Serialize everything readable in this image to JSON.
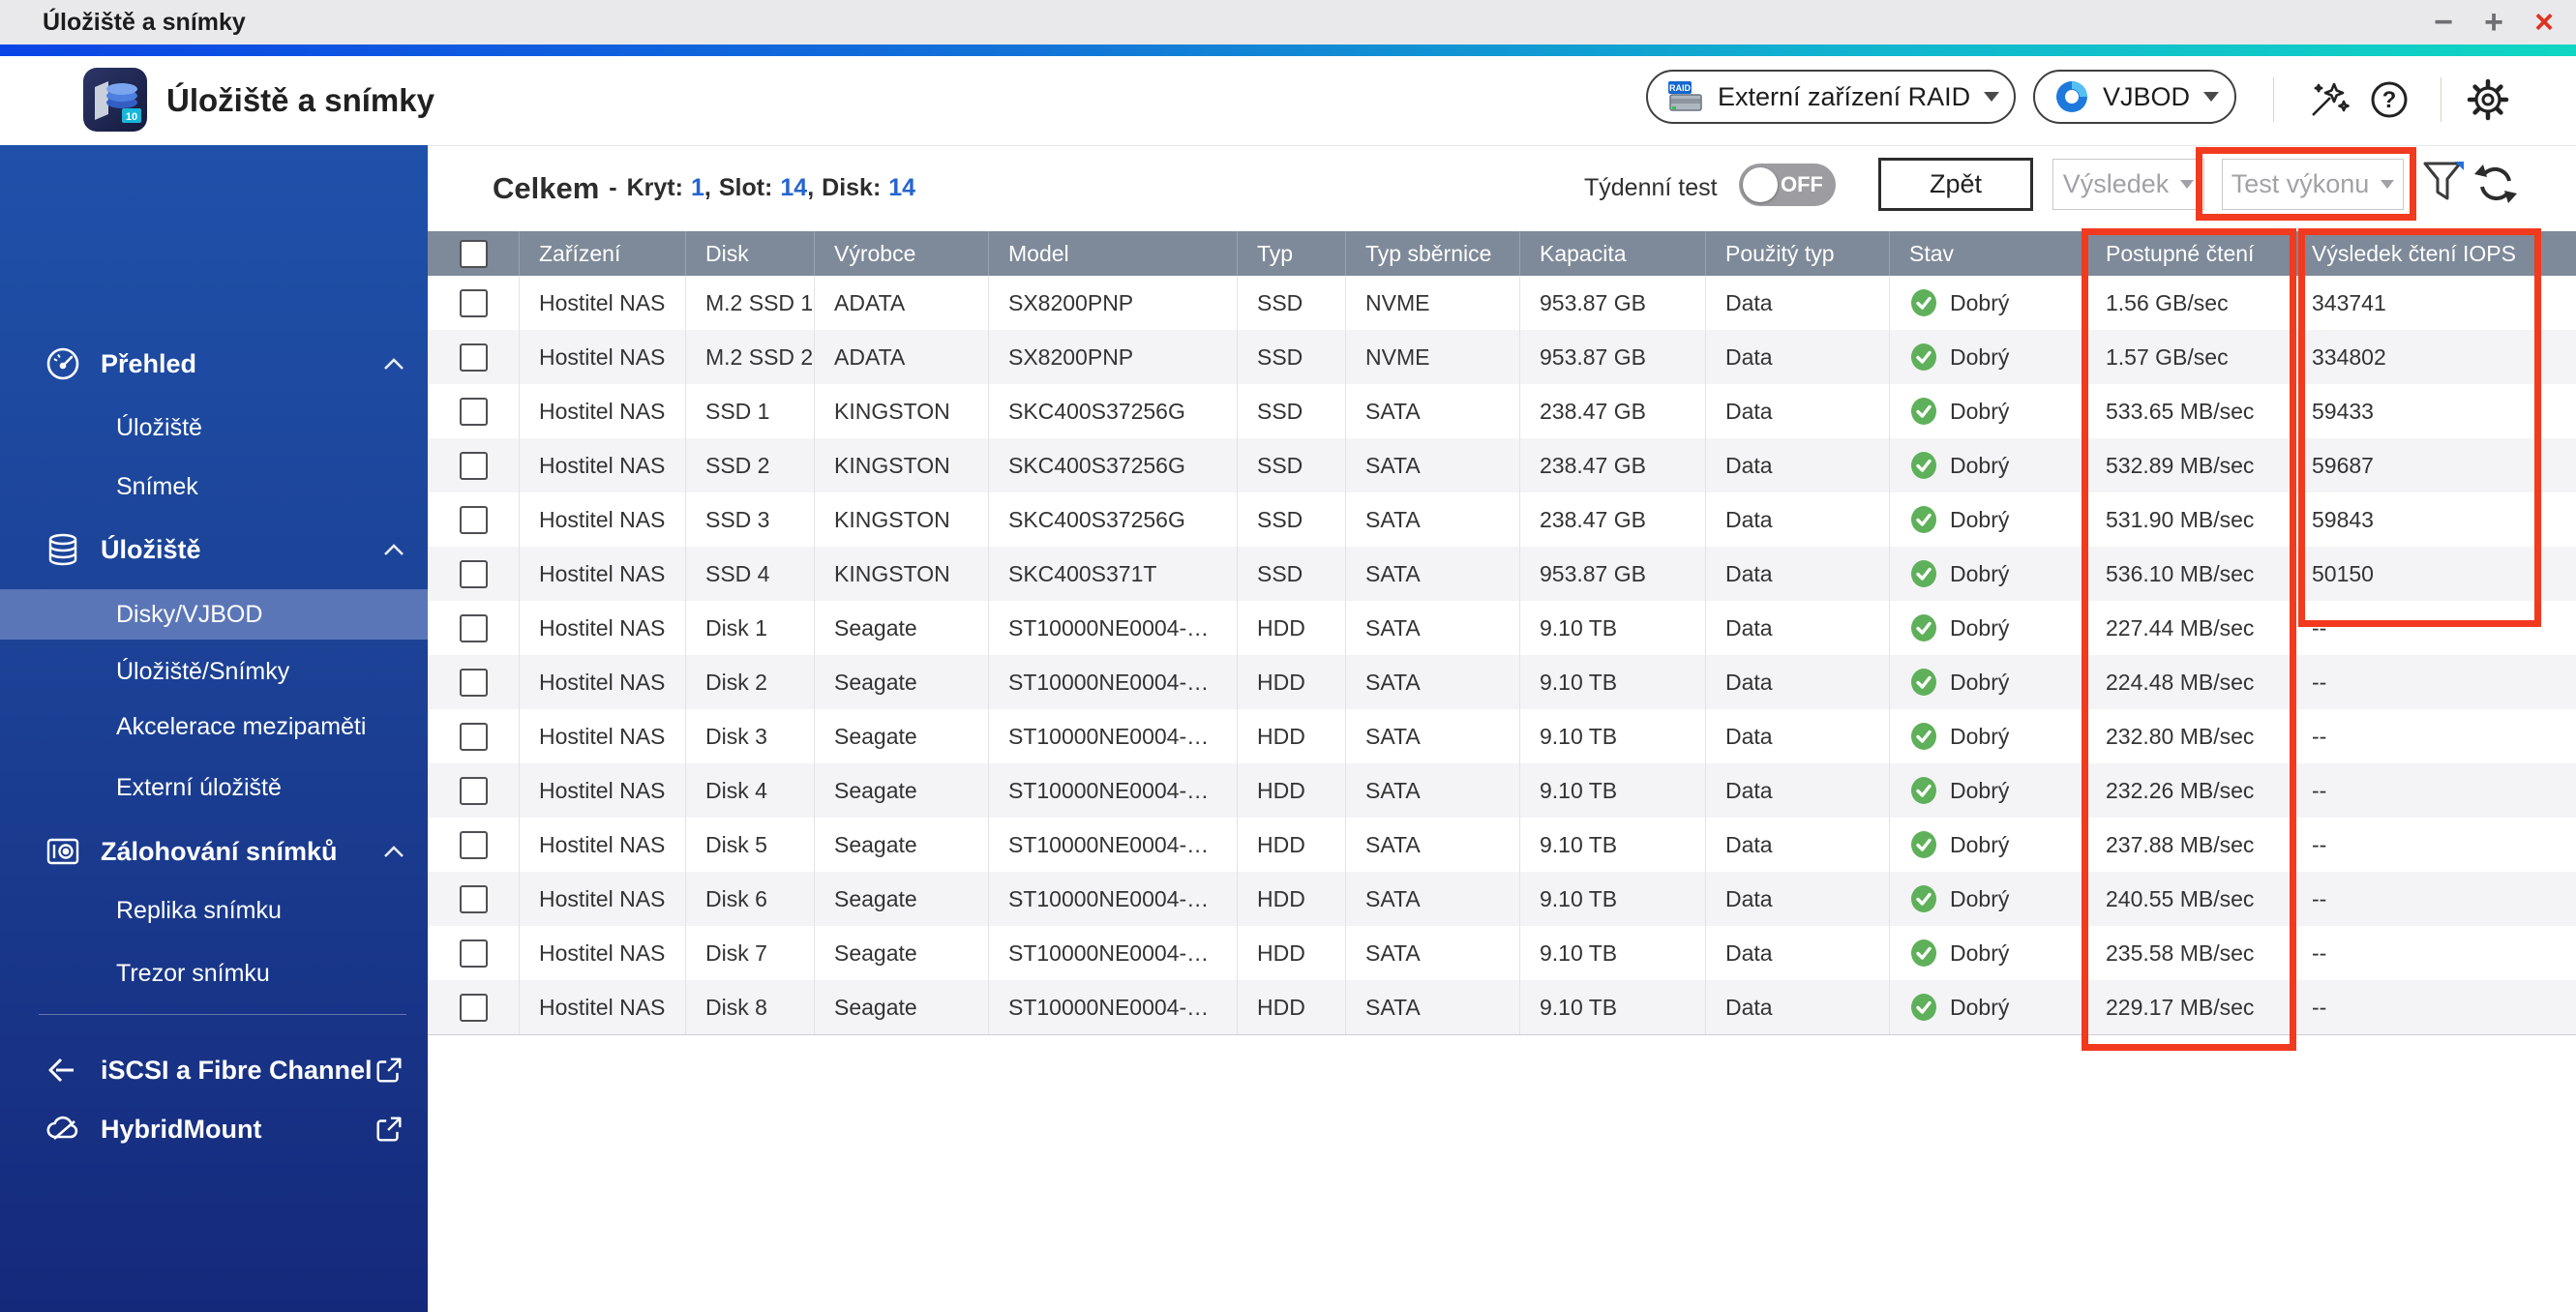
{
  "window": {
    "title": "Úložiště a snímky",
    "minimize": "−",
    "maximize": "+",
    "close": "×"
  },
  "app_header": {
    "title": "Úložiště a snímky",
    "app_icon_badge": "10",
    "raid_button_label": "Externí zařízení RAID",
    "raid_icon_text": "RAID",
    "vjbod_button_label": "VJBOD",
    "help_glyph": "?"
  },
  "sidebar": {
    "items": [
      {
        "label": "Přehled"
      },
      {
        "label": "Úložiště"
      },
      {
        "label": "Snímek"
      },
      {
        "label": "Úložiště"
      },
      {
        "label": "Disky/VJBOD"
      },
      {
        "label": "Úložiště/Snímky"
      },
      {
        "label": "Akcelerace mezipaměti"
      },
      {
        "label": "Externí úložiště"
      },
      {
        "label": "Zálohování snímků"
      },
      {
        "label": "Replika snímku"
      },
      {
        "label": "Trezor snímku"
      },
      {
        "label": "iSCSI a Fibre Channel"
      },
      {
        "label": "HybridMount"
      }
    ],
    "selected_item": "Disky/VJBOD"
  },
  "toolbar": {
    "summary": {
      "total": "Celkem",
      "dash": "-",
      "kryt_label": "Kryt:",
      "kryt_value": "1",
      "slot_label": "Slot:",
      "slot_value": "14",
      "disk_label": "Disk:",
      "disk_value": "14",
      "comma": ","
    },
    "weekly_test_label": "Týdenní test",
    "weekly_test_state": "OFF",
    "back_button": "Zpět",
    "result_button": "Výsledek",
    "performance_test_button": "Test výkonu"
  },
  "table": {
    "columns": [
      "Zařízení",
      "Disk",
      "Výrobce",
      "Model",
      "Typ",
      "Typ sběrnice",
      "Kapacita",
      "Použitý typ",
      "Stav",
      "Postupné čtení",
      "Výsledek čtení IOPS"
    ],
    "field_names": [
      "device",
      "disk",
      "vendor",
      "model",
      "type",
      "bus-type",
      "capacity",
      "used-type",
      "status",
      "seq-read",
      "read-iops"
    ],
    "rows": [
      [
        "Hostitel NAS",
        "M.2 SSD 1",
        "ADATA",
        "SX8200PNP",
        "SSD",
        "NVME",
        "953.87 GB",
        "Data",
        "Dobrý",
        "1.56 GB/sec",
        "343741"
      ],
      [
        "Hostitel NAS",
        "M.2 SSD 2",
        "ADATA",
        "SX8200PNP",
        "SSD",
        "NVME",
        "953.87 GB",
        "Data",
        "Dobrý",
        "1.57 GB/sec",
        "334802"
      ],
      [
        "Hostitel NAS",
        "SSD 1",
        "KINGSTON",
        "SKC400S37256G",
        "SSD",
        "SATA",
        "238.47 GB",
        "Data",
        "Dobrý",
        "533.65 MB/sec",
        "59433"
      ],
      [
        "Hostitel NAS",
        "SSD 2",
        "KINGSTON",
        "SKC400S37256G",
        "SSD",
        "SATA",
        "238.47 GB",
        "Data",
        "Dobrý",
        "532.89 MB/sec",
        "59687"
      ],
      [
        "Hostitel NAS",
        "SSD 3",
        "KINGSTON",
        "SKC400S37256G",
        "SSD",
        "SATA",
        "238.47 GB",
        "Data",
        "Dobrý",
        "531.90 MB/sec",
        "59843"
      ],
      [
        "Hostitel NAS",
        "SSD 4",
        "KINGSTON",
        "SKC400S371T",
        "SSD",
        "SATA",
        "953.87 GB",
        "Data",
        "Dobrý",
        "536.10 MB/sec",
        "50150"
      ],
      [
        "Hostitel NAS",
        "Disk 1",
        "Seagate",
        "ST10000NE0004-…",
        "HDD",
        "SATA",
        "9.10 TB",
        "Data",
        "Dobrý",
        "227.44 MB/sec",
        "--"
      ],
      [
        "Hostitel NAS",
        "Disk 2",
        "Seagate",
        "ST10000NE0004-…",
        "HDD",
        "SATA",
        "9.10 TB",
        "Data",
        "Dobrý",
        "224.48 MB/sec",
        "--"
      ],
      [
        "Hostitel NAS",
        "Disk 3",
        "Seagate",
        "ST10000NE0004-…",
        "HDD",
        "SATA",
        "9.10 TB",
        "Data",
        "Dobrý",
        "232.80 MB/sec",
        "--"
      ],
      [
        "Hostitel NAS",
        "Disk 4",
        "Seagate",
        "ST10000NE0004-…",
        "HDD",
        "SATA",
        "9.10 TB",
        "Data",
        "Dobrý",
        "232.26 MB/sec",
        "--"
      ],
      [
        "Hostitel NAS",
        "Disk 5",
        "Seagate",
        "ST10000NE0004-…",
        "HDD",
        "SATA",
        "9.10 TB",
        "Data",
        "Dobrý",
        "237.88 MB/sec",
        "--"
      ],
      [
        "Hostitel NAS",
        "Disk 6",
        "Seagate",
        "ST10000NE0004-…",
        "HDD",
        "SATA",
        "9.10 TB",
        "Data",
        "Dobrý",
        "240.55 MB/sec",
        "--"
      ],
      [
        "Hostitel NAS",
        "Disk 7",
        "Seagate",
        "ST10000NE0004-…",
        "HDD",
        "SATA",
        "9.10 TB",
        "Data",
        "Dobrý",
        "235.58 MB/sec",
        "--"
      ],
      [
        "Hostitel NAS",
        "Disk 8",
        "Seagate",
        "ST10000NE0004-…",
        "HDD",
        "SATA",
        "9.10 TB",
        "Data",
        "Dobrý",
        "229.17 MB/sec",
        "--"
      ]
    ]
  },
  "colors": {
    "accent_gradient_start": "#0a45e6",
    "accent_gradient_end": "#0fd6c2",
    "sidebar_blue_top": "#1f51aa",
    "sidebar_blue_bottom": "#15297b",
    "sidebar_selected": "#5b76b7",
    "table_header_gray": "#7e8a99",
    "status_green": "#5fb05a",
    "link_blue": "#2565d0",
    "annotation_red": "#f23a1e",
    "close_red": "#e0321f"
  }
}
